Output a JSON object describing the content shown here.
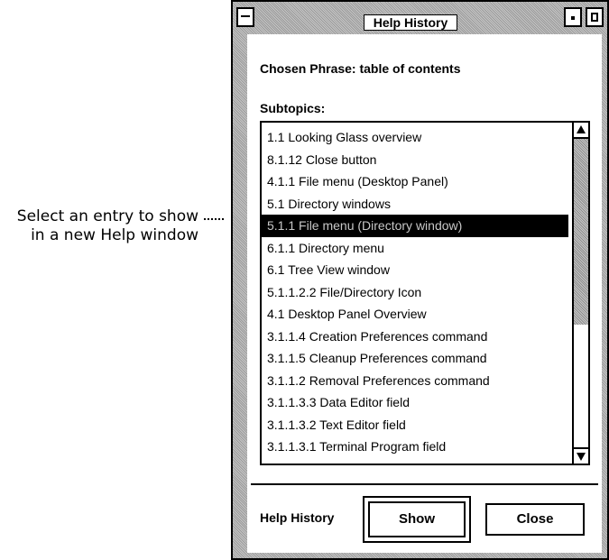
{
  "callout": {
    "text": "Select an entry to show in a new Help window"
  },
  "window": {
    "title": "Help History",
    "chosen_phrase": "Chosen Phrase: table of contents",
    "subtopics_label": "Subtopics:",
    "subtopics": [
      "1.1  Looking Glass overview",
      "8.1.12  Close button",
      "4.1.1  File menu (Desktop Panel)",
      "5.1  Directory windows",
      "5.1.1  File menu (Directory window)",
      "6.1.1  Directory menu",
      "6.1  Tree View window",
      "5.1.1.2.2  File/Directory Icon",
      "4.1  Desktop Panel Overview",
      "3.1.1.4  Creation Preferences command",
      "3.1.1.5  Cleanup Preferences command",
      "3.1.1.2  Removal Preferences command",
      "3.1.1.3.3  Data Editor field",
      "3.1.1.3.2  Text Editor field",
      "3.1.1.3.1  Terminal Program field"
    ],
    "selected_index": 4,
    "footer_label": "Help History",
    "show_label": "Show",
    "close_label": "Close"
  }
}
